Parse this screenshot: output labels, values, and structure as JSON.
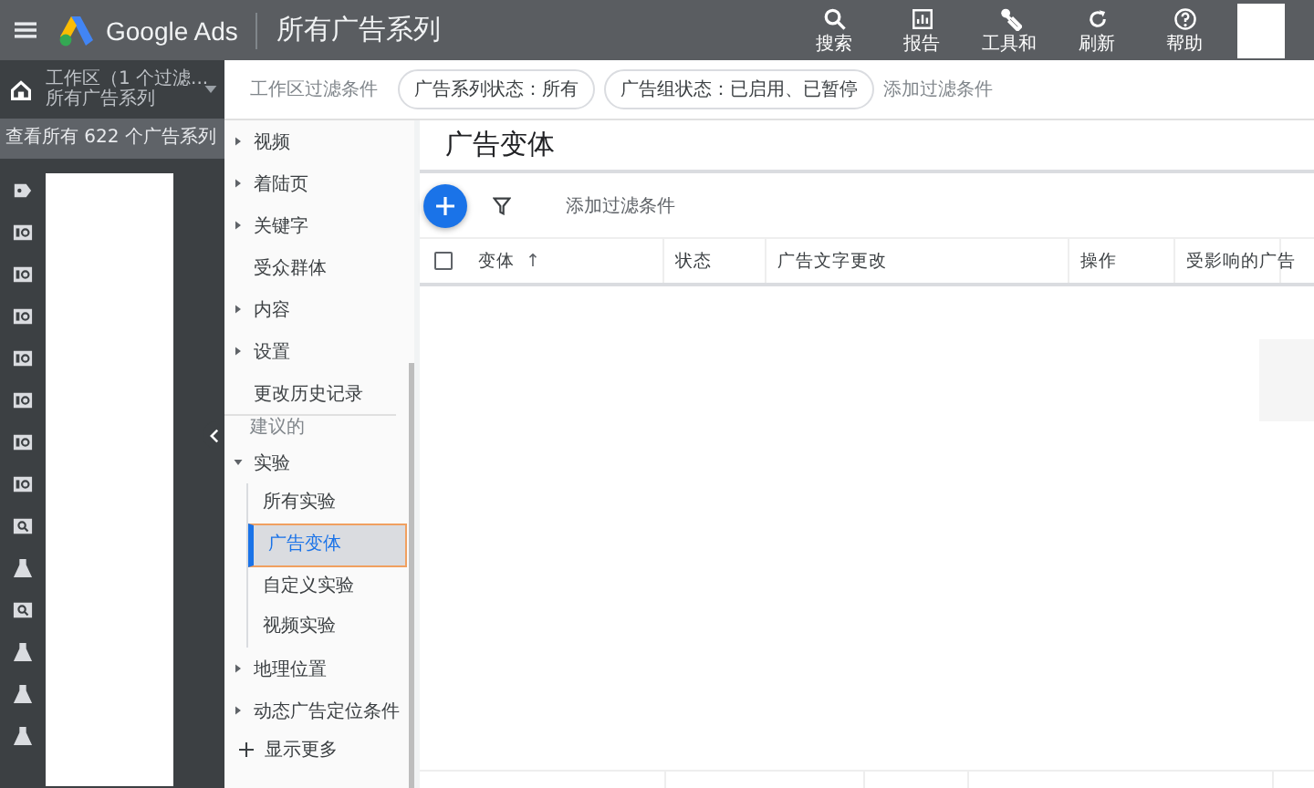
{
  "top_bar": {
    "product": "Google Ads",
    "page_title": "所有广告系列",
    "actions": [
      {
        "kind": "search",
        "label": "搜索"
      },
      {
        "kind": "report",
        "label": "报告"
      },
      {
        "kind": "tools",
        "label": "工具和"
      },
      {
        "kind": "refresh",
        "label": "刷新"
      },
      {
        "kind": "help",
        "label": "帮助"
      }
    ]
  },
  "workspace": {
    "title": "工作区（1 个过滤...",
    "subtitle": "所有广告系列",
    "view_all": "查看所有 622 个广告系列"
  },
  "rail_items": [
    {
      "kind": "tag"
    },
    {
      "kind": "ad"
    },
    {
      "kind": "ad"
    },
    {
      "kind": "ad"
    },
    {
      "kind": "ad"
    },
    {
      "kind": "ad"
    },
    {
      "kind": "ad"
    },
    {
      "kind": "ad"
    },
    {
      "kind": "search"
    },
    {
      "kind": "flask"
    },
    {
      "kind": "search"
    },
    {
      "kind": "flask"
    },
    {
      "kind": "flask"
    },
    {
      "kind": "flask"
    }
  ],
  "filter_bar": {
    "label": "工作区过滤条件",
    "chips": [
      "广告系列状态：所有",
      "广告组状态：已启用、已暂停"
    ],
    "add": "添加过滤条件"
  },
  "nav": [
    {
      "kind": "item",
      "label": "视频",
      "arrow": true
    },
    {
      "kind": "item",
      "label": "着陆页",
      "arrow": true
    },
    {
      "kind": "item",
      "label": "关键字",
      "arrow": true
    },
    {
      "kind": "item",
      "label": "受众群体",
      "arrow": false
    },
    {
      "kind": "item",
      "label": "内容",
      "arrow": true
    },
    {
      "kind": "item",
      "label": "设置",
      "arrow": true
    },
    {
      "kind": "item",
      "label": "更改历史记录",
      "arrow": false
    },
    {
      "kind": "section",
      "label": "建议的"
    },
    {
      "kind": "group",
      "label": "实验",
      "expanded": true,
      "children": [
        {
          "label": "所有实验",
          "selected": false
        },
        {
          "label": "广告变体",
          "selected": true
        },
        {
          "label": "自定义实验",
          "selected": false
        },
        {
          "label": "视频实验",
          "selected": false
        }
      ]
    },
    {
      "kind": "item",
      "label": "地理位置",
      "arrow": true
    },
    {
      "kind": "item",
      "label": "动态广告定位条件",
      "arrow": true
    },
    {
      "kind": "more",
      "label": "显示更多"
    }
  ],
  "content": {
    "title": "广告变体",
    "add_filter": "添加过滤条件",
    "columns": [
      {
        "label": "变体",
        "sort": "↑"
      },
      {
        "label": "状态"
      },
      {
        "label": "广告文字更改"
      },
      {
        "label": "操作"
      },
      {
        "label": "受影响的广告"
      }
    ],
    "select_all_checked": false
  }
}
